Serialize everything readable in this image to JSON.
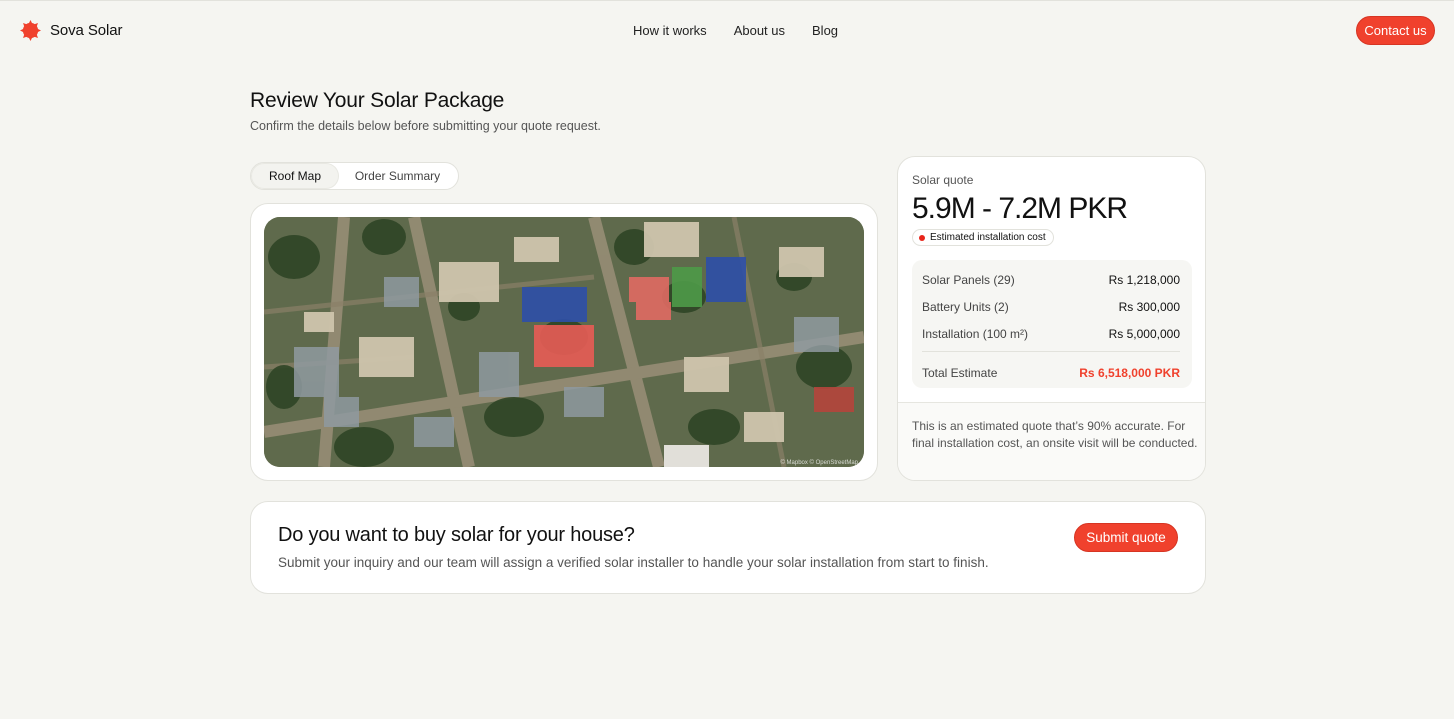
{
  "brand": {
    "name": "Sova Solar",
    "accent": "#f0412d",
    "logo_icon": "sun-badge-icon"
  },
  "nav": {
    "items": [
      {
        "label": "How it works"
      },
      {
        "label": "About us"
      },
      {
        "label": "Blog"
      }
    ],
    "contact_label": "Contact us"
  },
  "page": {
    "title": "Review Your Solar Package",
    "subtitle": "Confirm the details below before submitting your quote request."
  },
  "tabs": [
    {
      "label": "Roof Map",
      "active": true
    },
    {
      "label": "Order Summary",
      "active": false
    }
  ],
  "map": {
    "attribution": "© Mapbox © OpenStreetMap"
  },
  "quote": {
    "label": "Solar quote",
    "range": "5.9M - 7.2M PKR",
    "badge": "Estimated installation cost",
    "items": [
      {
        "label": "Solar Panels (29)",
        "value": "Rs 1,218,000"
      },
      {
        "label": "Battery Units (2)",
        "value": "Rs 300,000"
      },
      {
        "label": "Installation (100 m²)",
        "value": "Rs 5,000,000"
      }
    ],
    "total": {
      "label": "Total Estimate",
      "value": "Rs 6,518,000 PKR"
    },
    "note": "This is an estimated quote that’s 90% accurate. For final installation cost, an onsite visit will be conducted."
  },
  "cta": {
    "title": "Do you want to buy solar for your house?",
    "subtitle": "Submit your inquiry and our team will assign a verified solar installer to handle your solar installation from start to finish.",
    "button": "Submit quote"
  }
}
